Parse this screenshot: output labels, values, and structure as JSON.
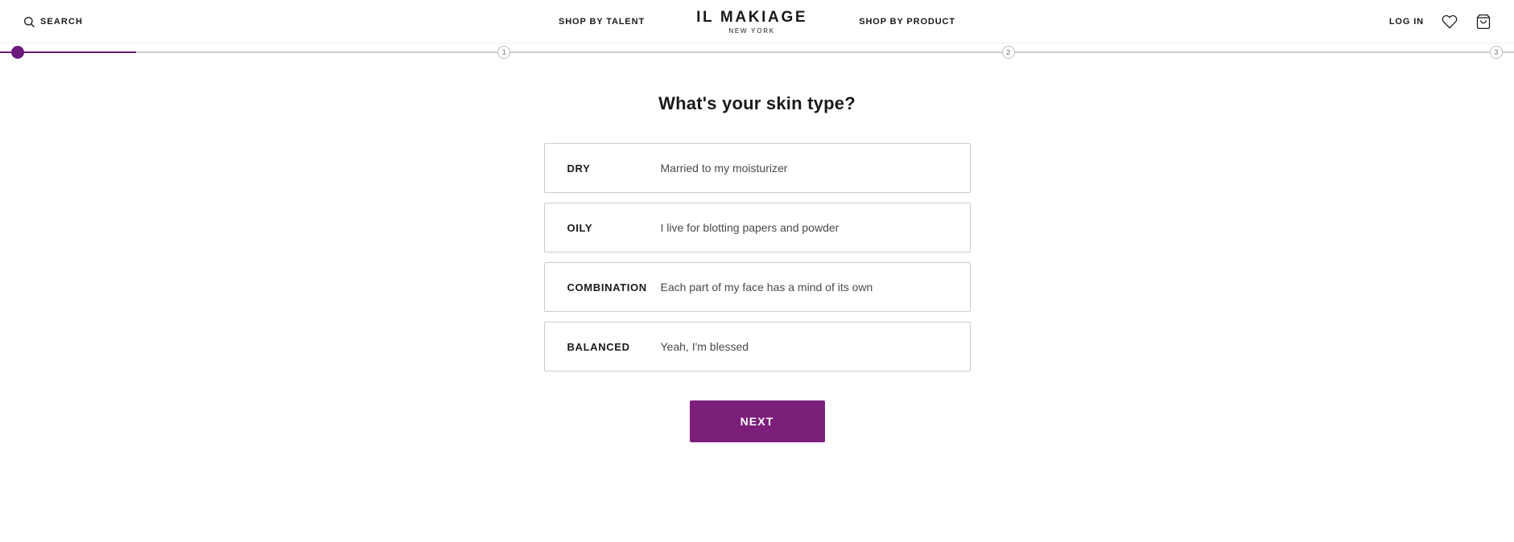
{
  "header": {
    "search_label": "SEARCH",
    "nav_left": "SHOP BY TALENT",
    "brand_name": "IL MAKIAGE",
    "brand_location": "NEW YORK",
    "nav_right": "SHOP BY PRODUCT",
    "login_label": "LOG IN"
  },
  "progress": {
    "steps": [
      {
        "id": "step-0",
        "number": "",
        "active": true
      },
      {
        "id": "step-1",
        "number": "1",
        "active": false
      },
      {
        "id": "step-2",
        "number": "2",
        "active": false
      },
      {
        "id": "step-3",
        "number": "3",
        "active": false
      }
    ],
    "fill_percent": "10%"
  },
  "quiz": {
    "question": "What's your skin type?",
    "options": [
      {
        "id": "dry",
        "label": "DRY",
        "description": "Married to my moisturizer"
      },
      {
        "id": "oily",
        "label": "OILY",
        "description": "I live for blotting papers and powder"
      },
      {
        "id": "combination",
        "label": "COMBINATION",
        "description": "Each part of my face has a mind of its own"
      },
      {
        "id": "balanced",
        "label": "BALANCED",
        "description": "Yeah, I'm blessed"
      }
    ],
    "next_button": "Next"
  }
}
